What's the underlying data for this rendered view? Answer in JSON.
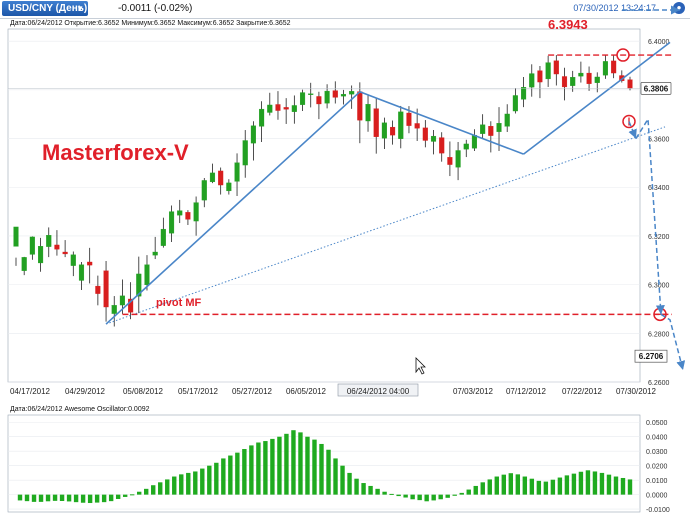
{
  "header": {
    "symbol": "USD/CNY (День)",
    "change": "-0.0011 (-0.02%)",
    "datetime": "07/30/2012 13:24:17"
  },
  "price_info": "Дата:06/24/2012 Открытие:6.3652 Минимум:6.3652 Максимум:6.3652 Закрытие:6.3652",
  "osc_info": "Дата:06/24/2012 Awesome Oscillator:0.0092",
  "colors": {
    "up": "#22a022",
    "down": "#d81e1e",
    "trend": "#4a86c8",
    "annot": "#e0202a"
  },
  "chart_data": [
    {
      "type": "candlestick",
      "title": "USD/CNY (День)",
      "x_tick_labels": [
        "04/17/2012",
        "04/29/2012",
        "05/08/2012",
        "05/17/2012",
        "05/27/2012",
        "06/05/2012",
        "06/24/2012 04:00",
        "07/03/2012",
        "07/12/2012",
        "07/22/2012",
        "07/30/2012"
      ],
      "y_ticks": [
        "6.4000",
        "6.3800",
        "6.3600",
        "6.3400",
        "6.3200",
        "6.3000",
        "6.2800",
        "6.2600"
      ],
      "ylim": [
        6.26,
        6.405
      ],
      "grid": true,
      "last_price": "6.3806",
      "cursor_price": "6.2706",
      "annotations": {
        "brand": "Masterforex-V",
        "peak": "6.3943",
        "pivot": "pivot MF"
      },
      "candles": [
        [
          6.3157,
          6.3237,
          6.3111,
          6.3077
        ],
        [
          6.3057,
          6.3112,
          6.3114,
          6.3039
        ],
        [
          6.3124,
          6.3196,
          6.3198,
          6.3102
        ],
        [
          6.3089,
          6.3158,
          6.3192,
          6.3053
        ],
        [
          6.3156,
          6.3203,
          6.3235,
          6.3113
        ],
        [
          6.3163,
          6.3145,
          6.3224,
          6.3119
        ],
        [
          6.3134,
          6.3126,
          6.3183,
          6.3113
        ],
        [
          6.3078,
          6.3123,
          6.3136,
          6.3035
        ],
        [
          6.3017,
          6.3082,
          6.3093,
          6.2978
        ],
        [
          6.3093,
          6.308,
          6.3151,
          6.3005
        ],
        [
          6.2994,
          6.2963,
          6.3037,
          6.2915
        ],
        [
          6.3057,
          6.2908,
          6.3097,
          6.2848
        ],
        [
          6.2881,
          6.2915,
          6.2953,
          6.2828
        ],
        [
          6.2916,
          6.2954,
          6.3021,
          6.288
        ],
        [
          6.2941,
          6.2886,
          6.301,
          6.2858
        ],
        [
          6.2952,
          6.3044,
          6.3115,
          6.2883
        ],
        [
          6.2999,
          6.3082,
          6.3121,
          6.2976
        ],
        [
          6.3121,
          6.3134,
          6.3196,
          6.3105
        ],
        [
          6.316,
          6.3228,
          6.3275,
          6.3152
        ],
        [
          6.3211,
          6.33,
          6.3325,
          6.3175
        ],
        [
          6.3285,
          6.3304,
          6.3348,
          6.3253
        ],
        [
          6.3297,
          6.3268,
          6.3306,
          6.3245
        ],
        [
          6.3261,
          6.3337,
          6.3362,
          6.3201
        ],
        [
          6.3347,
          6.3428,
          6.3438,
          6.3318
        ],
        [
          6.3422,
          6.3459,
          6.3497,
          6.3417
        ],
        [
          6.3467,
          6.3409,
          6.3481,
          6.337
        ],
        [
          6.3385,
          6.3418,
          6.3433,
          6.337
        ],
        [
          6.3424,
          6.3501,
          6.3539,
          6.3364
        ],
        [
          6.3491,
          6.3592,
          6.3635,
          6.3439
        ],
        [
          6.3581,
          6.3653,
          6.3671,
          6.351
        ],
        [
          6.365,
          6.3721,
          6.3753,
          6.3586
        ],
        [
          6.3707,
          6.3738,
          6.3788,
          6.3695
        ],
        [
          6.374,
          6.3715,
          6.3795,
          6.3677
        ],
        [
          6.3728,
          6.372,
          6.3766,
          6.366
        ],
        [
          6.371,
          6.3736,
          6.3777,
          6.3661
        ],
        [
          6.3739,
          6.3789,
          6.3801,
          6.3713
        ],
        [
          6.3783,
          6.3784,
          6.3829,
          6.3728
        ],
        [
          6.3773,
          6.3742,
          6.3792,
          6.368
        ],
        [
          6.3745,
          6.3795,
          6.3823,
          6.3724
        ],
        [
          6.3797,
          6.3769,
          6.3835,
          6.3744
        ],
        [
          6.3774,
          6.3782,
          6.38,
          6.374
        ],
        [
          6.3782,
          6.3794,
          6.3818,
          6.3722
        ],
        [
          6.3793,
          6.3675,
          6.3831,
          6.3581
        ],
        [
          6.3672,
          6.3741,
          6.378,
          6.3628
        ],
        [
          6.3723,
          6.3607,
          6.3767,
          6.3538
        ],
        [
          6.3601,
          6.3665,
          6.3686,
          6.3557
        ],
        [
          6.3647,
          6.3614,
          6.3674,
          6.3575
        ],
        [
          6.3599,
          6.371,
          6.3734,
          6.356
        ],
        [
          6.3705,
          6.3653,
          6.3733,
          6.3622
        ],
        [
          6.3662,
          6.3642,
          6.3723,
          6.359
        ],
        [
          6.3644,
          6.3592,
          6.3676,
          6.3564
        ],
        [
          6.3588,
          6.361,
          6.3635,
          6.3535
        ],
        [
          6.3604,
          6.354,
          6.3626,
          6.3505
        ],
        [
          6.3523,
          6.3493,
          6.3588,
          6.3446
        ],
        [
          6.3482,
          6.3551,
          6.3586,
          6.3429
        ],
        [
          6.3556,
          6.3578,
          6.3595,
          6.3524
        ],
        [
          6.356,
          6.3614,
          6.3638,
          6.3549
        ],
        [
          6.362,
          6.3657,
          6.37,
          6.3601
        ],
        [
          6.3651,
          6.3612,
          6.3671,
          6.3543
        ],
        [
          6.3628,
          6.3663,
          6.3729,
          6.3549
        ],
        [
          6.365,
          6.3701,
          6.3741,
          6.3627
        ],
        [
          6.3713,
          6.3777,
          6.3807,
          6.3703
        ],
        [
          6.3761,
          6.3811,
          6.3853,
          6.3729
        ],
        [
          6.3811,
          6.3867,
          6.3905,
          6.3772
        ],
        [
          6.3879,
          6.3832,
          6.3898,
          6.3766
        ],
        [
          6.3845,
          6.3912,
          6.394,
          6.3812
        ],
        [
          6.392,
          6.3865,
          6.3943,
          6.3818
        ],
        [
          6.3855,
          6.3812,
          6.3891,
          6.3757
        ],
        [
          6.3817,
          6.3852,
          6.3878,
          6.3792
        ],
        [
          6.3856,
          6.3869,
          6.3916,
          6.383
        ],
        [
          6.3869,
          6.3825,
          6.3896,
          6.3796
        ],
        [
          6.3829,
          6.3853,
          6.3872,
          6.379
        ],
        [
          6.386,
          6.3917,
          6.3942,
          6.3845
        ],
        [
          6.3919,
          6.3869,
          6.3943,
          6.3848
        ],
        [
          6.3859,
          6.3837,
          6.388,
          6.383
        ],
        [
          6.3842,
          6.3806,
          6.3854,
          6.3798
        ]
      ]
    },
    {
      "type": "bar",
      "title": "Awesome Oscillator",
      "y_ticks": [
        "0.0500",
        "0.0400",
        "0.0300",
        "0.0200",
        "0.0100",
        "0.0000",
        "-0.0100"
      ],
      "ylim": [
        -0.012,
        0.055
      ],
      "values": [
        -0.004,
        -0.0045,
        -0.005,
        -0.005,
        -0.0046,
        -0.0043,
        -0.0044,
        -0.0047,
        -0.0052,
        -0.0056,
        -0.0058,
        -0.0055,
        -0.0052,
        -0.0045,
        -0.003,
        -0.0016,
        0.0002,
        0.002,
        0.004,
        0.0065,
        0.0085,
        0.0105,
        0.0125,
        0.014,
        0.015,
        0.016,
        0.018,
        0.02,
        0.022,
        0.025,
        0.027,
        0.029,
        0.0315,
        0.034,
        0.036,
        0.037,
        0.0385,
        0.04,
        0.042,
        0.0445,
        0.043,
        0.04,
        0.038,
        0.035,
        0.031,
        0.025,
        0.02,
        0.015,
        0.011,
        0.008,
        0.006,
        0.004,
        0.002,
        0.0005,
        -0.001,
        -0.002,
        -0.0032,
        -0.0038,
        -0.0046,
        -0.004,
        -0.0032,
        -0.0022,
        -0.0008,
        0.0012,
        0.0035,
        0.006,
        0.0085,
        0.0105,
        0.0125,
        0.0138,
        0.0148,
        0.014,
        0.0125,
        0.011,
        0.0095,
        0.009,
        0.0103,
        0.0118,
        0.0133,
        0.0145,
        0.0158,
        0.0168,
        0.016,
        0.015,
        0.0138,
        0.0125,
        0.0115,
        0.0105
      ]
    }
  ]
}
